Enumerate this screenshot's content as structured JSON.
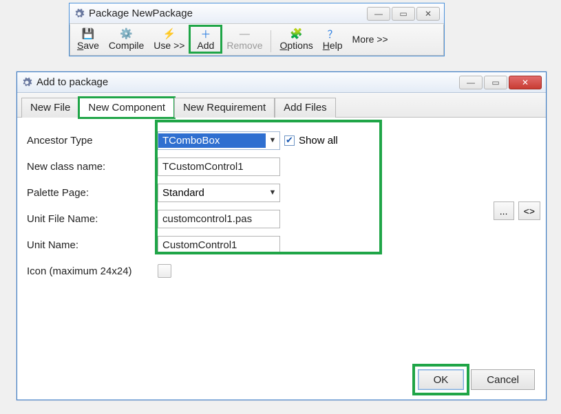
{
  "parent": {
    "title": "Package NewPackage",
    "toolbar": {
      "save": "Save",
      "compile": "Compile",
      "use": "Use >>",
      "add": "Add",
      "remove": "Remove",
      "options": "Options",
      "help": "Help",
      "more": "More >>"
    }
  },
  "dialog": {
    "title": "Add to package",
    "tabs": {
      "new_file": "New File",
      "new_component": "New Component",
      "new_requirement": "New Requirement",
      "add_files": "Add Files"
    },
    "labels": {
      "ancestor": "Ancestor Type",
      "classname": "New class name:",
      "palette": "Palette Page:",
      "unitfile": "Unit File Name:",
      "unitname": "Unit Name:",
      "icon": "Icon (maximum 24x24)"
    },
    "values": {
      "ancestor": "TComboBox",
      "showall": "Show all",
      "classname": "TCustomControl1",
      "palette": "Standard",
      "unitfile": "customcontrol1.pas",
      "unitname": "CustomControl1"
    },
    "sidebuttons": {
      "browse": "...",
      "expand": "<>"
    },
    "buttons": {
      "ok": "OK",
      "cancel": "Cancel"
    }
  }
}
